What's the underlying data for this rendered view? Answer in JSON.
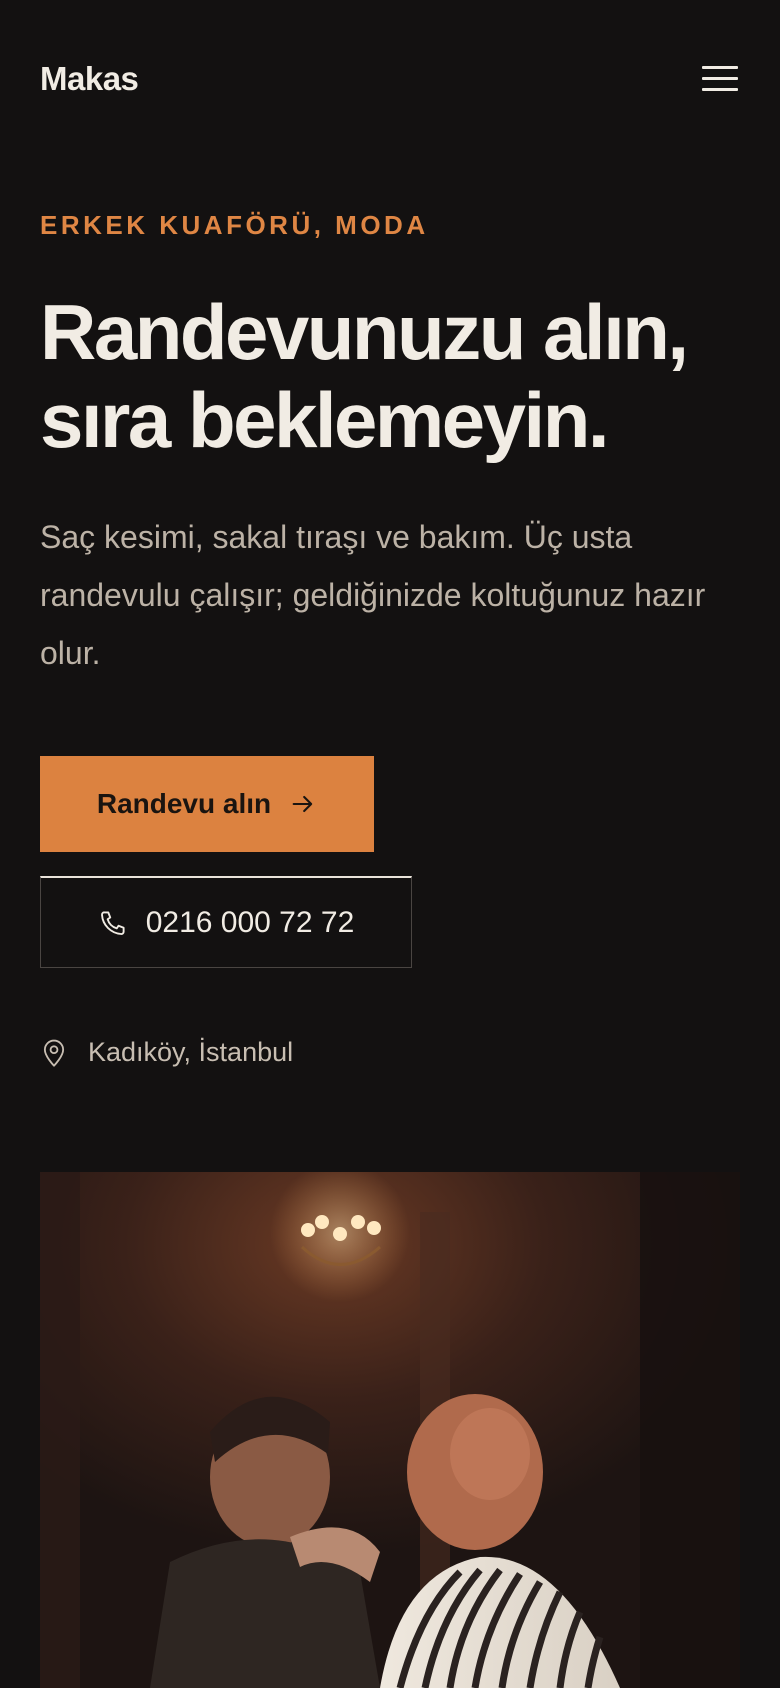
{
  "brand": {
    "name": "Makas"
  },
  "nav": {
    "menu_icon": "hamburger-menu-icon"
  },
  "hero": {
    "eyebrow": "ERKEK KUAFÖRÜ, MODA",
    "title_line1": "Randevunuzu alın,",
    "title_line2": "sıra beklemeyin.",
    "description": "Saç kesimi, sakal tıraşı ve bakım. Üç usta randevulu çalışır; geldiğinizde koltuğunuz hazır olur."
  },
  "actions": {
    "primary_label": "Randevu alın",
    "primary_icon": "arrow-right-icon",
    "phone_label": "0216 000 72 72",
    "phone_icon": "phone-icon"
  },
  "location": {
    "text": "Kadıköy, İstanbul",
    "icon": "map-pin-icon"
  },
  "colors": {
    "background": "#131111",
    "accent": "#dc8240",
    "text": "#f1ece4",
    "muted": "#bcb2a6"
  }
}
